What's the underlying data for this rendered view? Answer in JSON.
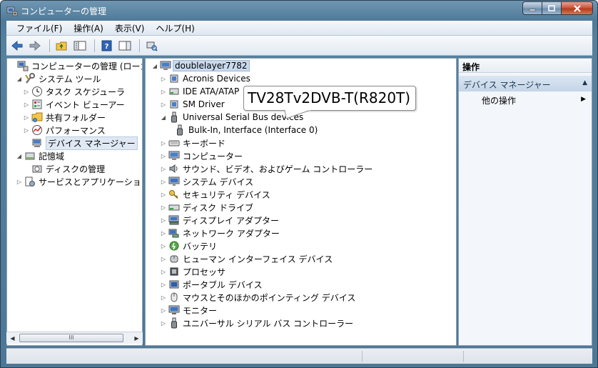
{
  "window": {
    "title": "コンピューターの管理"
  },
  "menu": [
    "ファイル(F)",
    "操作(A)",
    "表示(V)",
    "ヘルプ(H)"
  ],
  "left_tree": [
    {
      "label": "コンピューターの管理 (ローカ",
      "icon": "computer-management-icon",
      "exp": "",
      "level": 0
    },
    {
      "label": "システム ツール",
      "icon": "system-tools-icon",
      "exp": "◢",
      "level": 1
    },
    {
      "label": "タスク スケジューラ",
      "icon": "clock-icon",
      "exp": "▷",
      "level": 2
    },
    {
      "label": "イベント ビューアー",
      "icon": "event-viewer-icon",
      "exp": "▷",
      "level": 2
    },
    {
      "label": "共有フォルダー",
      "icon": "shared-folder-icon",
      "exp": "▷",
      "level": 2
    },
    {
      "label": "パフォーマンス",
      "icon": "performance-icon",
      "exp": "▷",
      "level": 2
    },
    {
      "label": "デバイス マネージャー",
      "icon": "device-manager-icon",
      "exp": "",
      "level": 2,
      "selected": true
    },
    {
      "label": "記憶域",
      "icon": "storage-icon",
      "exp": "◢",
      "level": 1
    },
    {
      "label": "ディスクの管理",
      "icon": "disk-management-icon",
      "exp": "",
      "level": 2
    },
    {
      "label": "サービスとアプリケーショ",
      "icon": "services-icon",
      "exp": "▷",
      "level": 1
    }
  ],
  "scroll_grip": "III",
  "device_tree": {
    "root": "doublelayer7782",
    "items": [
      {
        "label": "Acronis Devices",
        "icon": "device-icon",
        "exp": "▷",
        "level": 1
      },
      {
        "label": "IDE ATA/ATAP",
        "icon": "ide-icon",
        "exp": "▷",
        "level": 1
      },
      {
        "label": "SM Driver",
        "icon": "device-icon",
        "exp": "▷",
        "level": 1
      },
      {
        "label": "Universal Serial Bus devices",
        "icon": "usb-icon",
        "exp": "◢",
        "level": 1
      },
      {
        "label": "Bulk-In, Interface (Interface 0)",
        "icon": "usb-icon",
        "exp": "",
        "level": 2
      },
      {
        "label": "キーボード",
        "icon": "keyboard-icon",
        "exp": "▷",
        "level": 1
      },
      {
        "label": "コンピューター",
        "icon": "computer-icon",
        "exp": "▷",
        "level": 1
      },
      {
        "label": "サウンド、ビデオ、およびゲーム コントローラー",
        "icon": "sound-icon",
        "exp": "▷",
        "level": 1
      },
      {
        "label": "システム デバイス",
        "icon": "system-device-icon",
        "exp": "▷",
        "level": 1
      },
      {
        "label": "セキュリティ デバイス",
        "icon": "key-icon",
        "exp": "▷",
        "level": 1
      },
      {
        "label": "ディスク ドライブ",
        "icon": "disk-drive-icon",
        "exp": "▷",
        "level": 1
      },
      {
        "label": "ディスプレイ アダプター",
        "icon": "display-adapter-icon",
        "exp": "▷",
        "level": 1
      },
      {
        "label": "ネットワーク アダプター",
        "icon": "network-adapter-icon",
        "exp": "▷",
        "level": 1
      },
      {
        "label": "バッテリ",
        "icon": "battery-icon",
        "exp": "▷",
        "level": 1
      },
      {
        "label": "ヒューマン インターフェイス デバイス",
        "icon": "hid-icon",
        "exp": "▷",
        "level": 1
      },
      {
        "label": "プロセッサ",
        "icon": "processor-icon",
        "exp": "▷",
        "level": 1
      },
      {
        "label": "ポータブル デバイス",
        "icon": "portable-device-icon",
        "exp": "▷",
        "level": 1
      },
      {
        "label": "マウスとそのほかのポインティング デバイス",
        "icon": "mouse-icon",
        "exp": "▷",
        "level": 1
      },
      {
        "label": "モニター",
        "icon": "monitor-icon",
        "exp": "▷",
        "level": 1
      },
      {
        "label": "ユニバーサル シリアル バス コントローラー",
        "icon": "usb-controller-icon",
        "exp": "▷",
        "level": 1
      }
    ]
  },
  "callout": "TV28Tv2DVB-T(R820T)",
  "actions": {
    "header": "操作",
    "section": "デバイス マネージャー",
    "sub": "他の操作"
  },
  "colors": {
    "title_bar": "#5a86a6",
    "selection": "#c9d9ee",
    "action_section": "#c4d5e7"
  }
}
